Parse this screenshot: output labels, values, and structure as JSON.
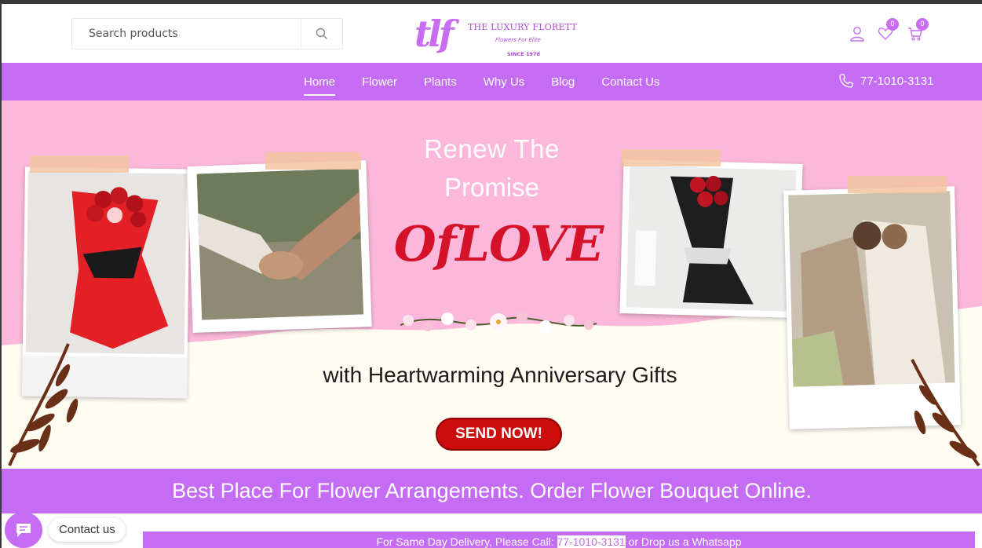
{
  "header": {
    "search_placeholder": "Search products",
    "logo": {
      "mark": "tlf",
      "brand": "THE LUXURY FLORETT",
      "tagline": "Flowers For Elite",
      "since": "SINCE 1978"
    },
    "icons": {
      "account": "user-icon",
      "wishlist": "heart-icon",
      "cart": "cart-icon"
    },
    "wishlist_count": "0",
    "cart_count": "0"
  },
  "nav": {
    "items": [
      {
        "label": "Home",
        "active": true
      },
      {
        "label": "Flower"
      },
      {
        "label": "Plants"
      },
      {
        "label": "Why Us"
      },
      {
        "label": "Blog"
      },
      {
        "label": "Contact Us"
      }
    ],
    "phone": "77-1010-3131"
  },
  "hero": {
    "line1": "Renew The",
    "line2": "Promise",
    "line3": "OfLOVE",
    "subtitle": "with Heartwarming Anniversary Gifts",
    "cta": "SEND NOW!"
  },
  "banner": {
    "text": "Best Place For Flower Arrangements. Order Flower Bouquet Online."
  },
  "delivery": {
    "prefix": "For Same Day Delivery, Please Call: ",
    "phone": "77-1010-3131",
    "suffix": " or Drop us a Whatsapp"
  },
  "chat": {
    "label": "Contact us"
  },
  "colors": {
    "accent": "#c46cf4",
    "hero_pink": "#fbb8da",
    "cta_red": "#cc0d0d",
    "love_red": "#d4132a"
  }
}
